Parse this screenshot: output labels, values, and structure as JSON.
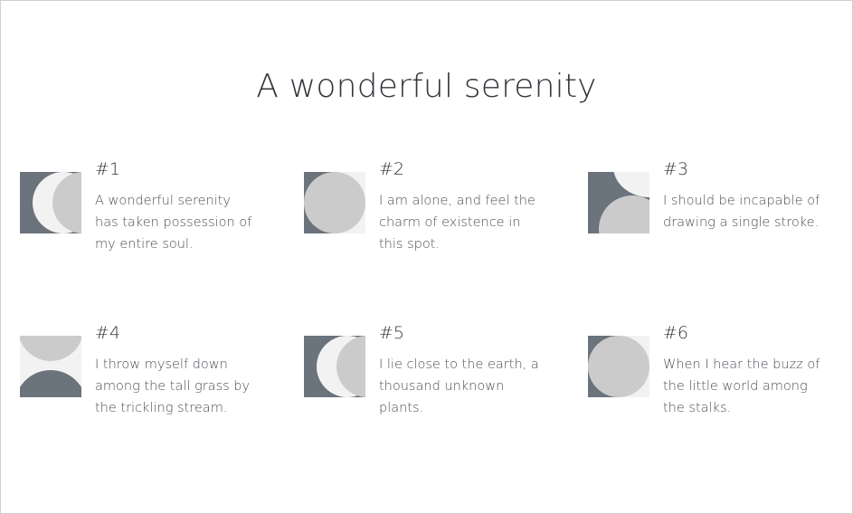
{
  "title": "A wonderful serenity",
  "colors": {
    "dark": "#6b737c",
    "light": "#f2f2f2",
    "mid": "#cbcbcb"
  },
  "items": [
    {
      "number": "#1",
      "text": "A wonderful serenity has taken possession of my entire soul.",
      "thumb": "two-half-circles-left"
    },
    {
      "number": "#2",
      "text": "I am alone, and feel the charm of existence in this spot.",
      "thumb": "circle-right"
    },
    {
      "number": "#3",
      "text": "I should be incapable of drawing a single stroke.",
      "thumb": "stacked-half-circles"
    },
    {
      "number": "#4",
      "text": "I throw myself down among the tall grass by the trickling stream.",
      "thumb": "top-bottom-half-circles"
    },
    {
      "number": "#5",
      "text": "I lie close to the earth, a thousand unknown plants.",
      "thumb": "two-half-circles-left"
    },
    {
      "number": "#6",
      "text": "When I hear the buzz of the little world among the stalks.",
      "thumb": "circle-left"
    }
  ]
}
